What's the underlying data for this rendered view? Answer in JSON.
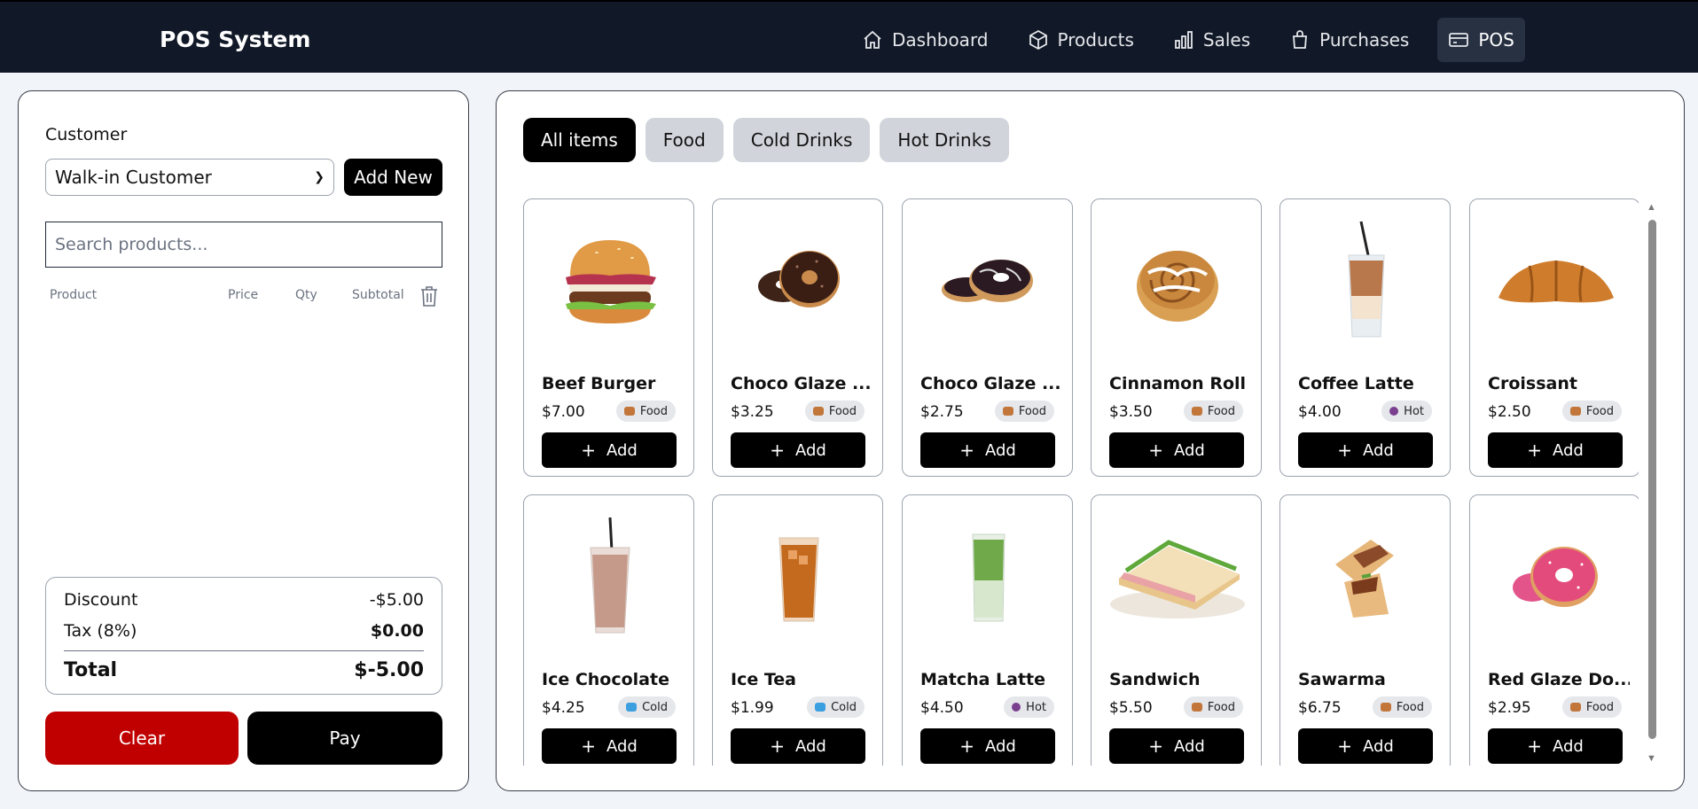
{
  "app": {
    "title": "POS System"
  },
  "nav": [
    {
      "label": "Dashboard",
      "icon": "home-icon"
    },
    {
      "label": "Products",
      "icon": "box-icon"
    },
    {
      "label": "Sales",
      "icon": "bar-chart-icon"
    },
    {
      "label": "Purchases",
      "icon": "shopping-bag-icon"
    },
    {
      "label": "POS",
      "icon": "credit-card-icon",
      "active": true
    }
  ],
  "customer": {
    "label": "Customer",
    "selected": "Walk-in Customer",
    "add_new_label": "Add New"
  },
  "search": {
    "placeholder": "Search products..."
  },
  "cart": {
    "headers": {
      "product": "Product",
      "price": "Price",
      "qty": "Qty",
      "subtotal": "Subtotal"
    },
    "items": []
  },
  "summary": {
    "discount_label": "Discount",
    "discount_value": "-$5.00",
    "tax_label": "Tax (8%)",
    "tax_value": "$0.00",
    "total_label": "Total",
    "total_value": "$-5.00"
  },
  "actions": {
    "clear_label": "Clear",
    "pay_label": "Pay"
  },
  "categories": [
    {
      "label": "All items",
      "active": true
    },
    {
      "label": "Food"
    },
    {
      "label": "Cold Drinks"
    },
    {
      "label": "Hot Drinks"
    }
  ],
  "add_label": "Add",
  "products": [
    {
      "name": "Beef Burger",
      "price": "$7.00",
      "badge": "Food",
      "image": "burger"
    },
    {
      "name": "Choco Glaze ...",
      "price": "$3.25",
      "badge": "Food",
      "image": "choco-donuts"
    },
    {
      "name": "Choco Glaze ...",
      "price": "$2.75",
      "badge": "Food",
      "image": "choco-glaze-donuts"
    },
    {
      "name": "Cinnamon Roll",
      "price": "$3.50",
      "badge": "Food",
      "image": "cinnamon-roll"
    },
    {
      "name": "Coffee Latte",
      "price": "$4.00",
      "badge": "Hot",
      "image": "iced-latte"
    },
    {
      "name": "Croissant",
      "price": "$2.50",
      "badge": "Food",
      "image": "croissant"
    },
    {
      "name": "Ice Chocolate",
      "price": "$4.25",
      "badge": "Cold",
      "image": "ice-chocolate"
    },
    {
      "name": "Ice Tea",
      "price": "$1.99",
      "badge": "Cold",
      "image": "ice-tea"
    },
    {
      "name": "Matcha Latte",
      "price": "$4.50",
      "badge": "Hot",
      "image": "matcha"
    },
    {
      "name": "Sandwich",
      "price": "$5.50",
      "badge": "Food",
      "image": "sandwich"
    },
    {
      "name": "Sawarma",
      "price": "$6.75",
      "badge": "Food",
      "image": "shawarma"
    },
    {
      "name": "Red Glaze Do...",
      "price": "$2.95",
      "badge": "Food",
      "image": "red-donut"
    }
  ],
  "badge_colors": {
    "Food": "#c2763a",
    "Hot": "#7b3f8f",
    "Cold": "#3b9fe0"
  },
  "colors": {
    "nav_bg": "#111827",
    "clear": "#c00000",
    "primary": "#000000"
  }
}
